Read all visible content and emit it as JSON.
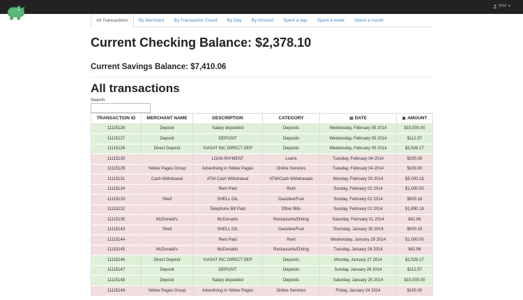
{
  "header": {
    "user_label": "test",
    "user_icon": "user-icon",
    "logo_icon": "dinosaur-logo-icon"
  },
  "tabs": [
    {
      "label": "All Transactions",
      "active": true
    },
    {
      "label": "By Merchant"
    },
    {
      "label": "By Transaction Count"
    },
    {
      "label": "By Day"
    },
    {
      "label": "By Amount"
    },
    {
      "label": "Spent a day"
    },
    {
      "label": "Spent a week"
    },
    {
      "label": "Spent a month"
    }
  ],
  "balances": {
    "checking": "Current Checking Balance: $2,378.10",
    "savings": "Current Savings Balance: $7,410.06"
  },
  "section_title": "All transactions",
  "search": {
    "label": "Search",
    "value": ""
  },
  "table": {
    "headers": {
      "id": "TRANSACTION ID",
      "merchant": "MERCHANT NAME",
      "description": "DESCRIPTION",
      "category": "CATEGORY",
      "date": "DATE",
      "amount": "AMOUNT"
    },
    "rows": [
      {
        "type": "credit",
        "id": "11115128",
        "merchant": "Deposit",
        "description": "Salary deposited",
        "category": "Deposits",
        "date": "Wednesday, February 05 2014",
        "amount": "$15,000.00"
      },
      {
        "type": "credit",
        "id": "11115127",
        "merchant": "Deposit",
        "description": "DEPOSIT",
        "category": "Deposits",
        "date": "Wednesday, February 05 2014",
        "amount": "$112.57"
      },
      {
        "type": "credit",
        "id": "11115126",
        "merchant": "Direct Deposit",
        "description": "VIASAT INC DIRECT DEP",
        "category": "Deposits",
        "date": "Wednesday, February 05 2014",
        "amount": "$2,526.17"
      },
      {
        "type": "debit",
        "id": "11115130",
        "merchant": "",
        "description": "LOAN PAYMENT",
        "category": "Loans",
        "date": "Tuesday, February 04 2014",
        "amount": "$200.00"
      },
      {
        "type": "debit",
        "id": "11115129",
        "merchant": "Yellow Pages Group",
        "description": "Advertising in Yellow Pages",
        "category": "Online Services",
        "date": "Tuesday, February 04 2014",
        "amount": "$100.00"
      },
      {
        "type": "debit",
        "id": "11115131",
        "merchant": "Cash Withdrawal",
        "description": "ATM Cash Withdrawal",
        "category": "ATM/Cash Withdrawals",
        "date": "Monday, February 03 2014",
        "amount": "$5,000.18"
      },
      {
        "type": "debit",
        "id": "11115134",
        "merchant": "",
        "description": "Rent Paid",
        "category": "Rent",
        "date": "Sunday, February 02 2014",
        "amount": "$1,000.00"
      },
      {
        "type": "debit",
        "id": "11115133",
        "merchant": "Shell",
        "description": "SHELL OIL",
        "category": "Gasoline/Fuel",
        "date": "Sunday, February 02 2014",
        "amount": "$500.18"
      },
      {
        "type": "debit",
        "id": "11115132",
        "merchant": "",
        "description": "Telephone Bill Paid",
        "category": "Other Bills",
        "date": "Sunday, February 02 2014",
        "amount": "$1,890.18"
      },
      {
        "type": "debit",
        "id": "11115135",
        "merchant": "McDonald's",
        "description": "McDonalds",
        "category": "Restaurants/Dining",
        "date": "Saturday, February 01 2014",
        "amount": "$42.96"
      },
      {
        "type": "debit",
        "id": "11115143",
        "merchant": "Shell",
        "description": "SHELL OIL",
        "category": "Gasoline/Fuel",
        "date": "Thursday, January 30 2014",
        "amount": "$500.18"
      },
      {
        "type": "debit",
        "id": "11115144",
        "merchant": "",
        "description": "Rent Paid",
        "category": "Rent",
        "date": "Wednesday, January 29 2014",
        "amount": "$1,000.00"
      },
      {
        "type": "debit",
        "id": "11115145",
        "merchant": "McDonald's",
        "description": "McDonalds",
        "category": "Restaurants/Dining",
        "date": "Tuesday, January 28 2014",
        "amount": "$42.96"
      },
      {
        "type": "credit",
        "id": "11115146",
        "merchant": "Direct Deposit",
        "description": "VIASAT INC DIRECT DEP",
        "category": "Deposits",
        "date": "Monday, January 27 2014",
        "amount": "$2,526.17"
      },
      {
        "type": "credit",
        "id": "11115147",
        "merchant": "Deposit",
        "description": "DEPOSIT",
        "category": "Deposits",
        "date": "Sunday, January 26 2014",
        "amount": "$112.57"
      },
      {
        "type": "credit",
        "id": "11115148",
        "merchant": "Deposit",
        "description": "Salary deposited",
        "category": "Deposits",
        "date": "Saturday, January 25 2014",
        "amount": "$15,000.00"
      },
      {
        "type": "debit",
        "id": "11115149",
        "merchant": "Yellow Pages Group",
        "description": "Advertising in Yellow Pages",
        "category": "Online Services",
        "date": "Friday, January 24 2014",
        "amount": "$100.00"
      }
    ]
  },
  "colors": {
    "navbar": "#222222",
    "link": "#428bca",
    "credit_row": "#dff0d8",
    "debit_row": "#f2dede",
    "logo": "#5cb87a"
  }
}
